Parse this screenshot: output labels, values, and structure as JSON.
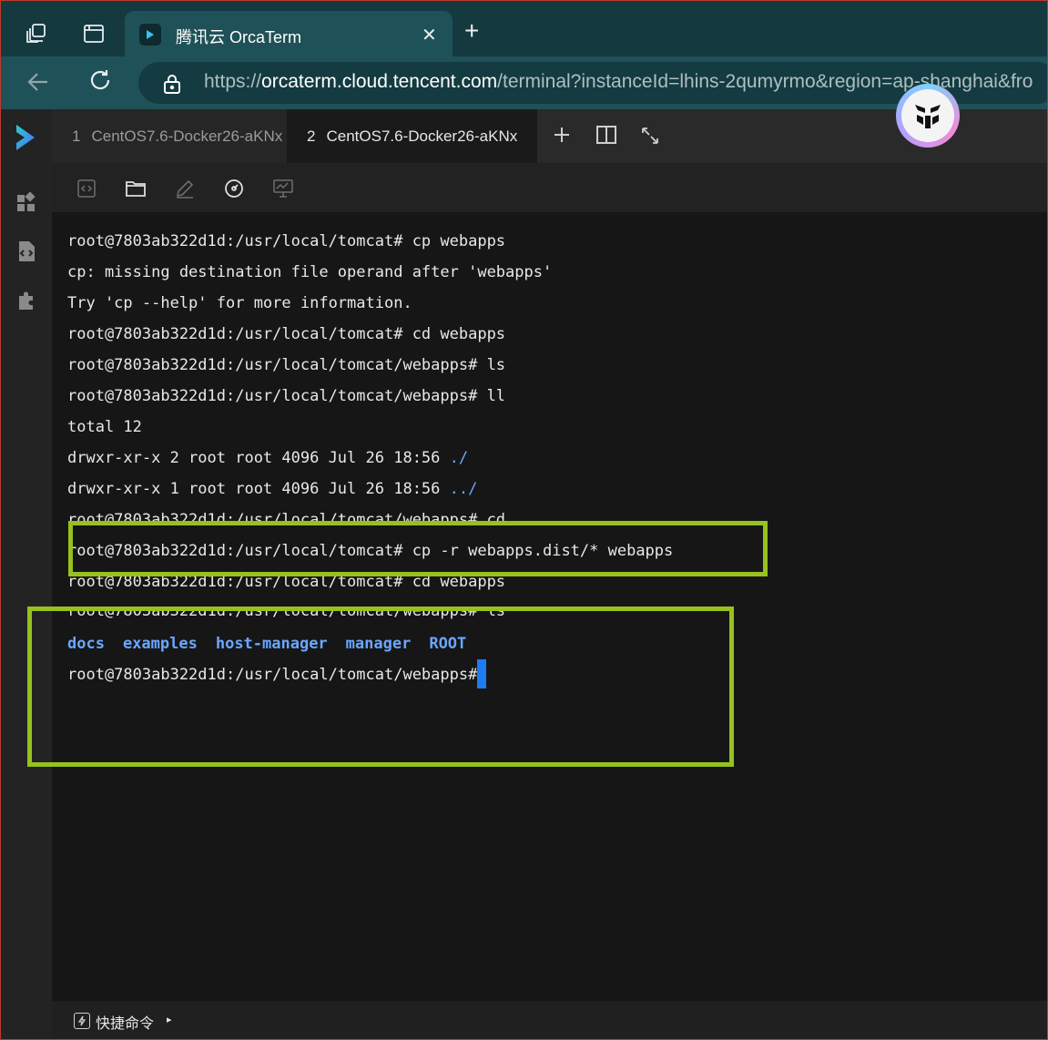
{
  "browser": {
    "tab_title": "腾讯云 OrcaTerm",
    "close_glyph": "✕",
    "new_tab_glyph": "+",
    "url_scheme": "https://",
    "url_host": "orcaterm.cloud.tencent.com",
    "url_path": "/terminal?instanceId=lhins-2qumyrmo&region=ap-shanghai&fro",
    "theme_color": "#1f5158"
  },
  "terminal_tabs": [
    {
      "num": "1",
      "label": "CentOS7.6-Docker26-aKNx"
    },
    {
      "num": "2",
      "label": "CentOS7.6-Docker26-aKNx"
    }
  ],
  "terminal": {
    "lines": [
      "root@7803ab322d1d:/usr/local/tomcat# cp webapps",
      "cp: missing destination file operand after 'webapps'",
      "Try 'cp --help' for more information.",
      "root@7803ab322d1d:/usr/local/tomcat# cd webapps",
      "root@7803ab322d1d:/usr/local/tomcat/webapps# ls",
      "root@7803ab322d1d:/usr/local/tomcat/webapps# ll",
      "total 12",
      "drwxr-xr-x 2 root root 4096 Jul 26 18:56 ",
      "drwxr-xr-x 1 root root 4096 Jul 26 18:56 ",
      "root@7803ab322d1d:/usr/local/tomcat/webapps# cd",
      "root@7803ab322d1d:/usr/local/tomcat# cp -r webapps.dist/* webapps",
      "root@7803ab322d1d:/usr/local/tomcat# cd webapps",
      "root@7803ab322d1d:/usr/local/tomcat/webapps# ls",
      "root@7803ab322d1d:/usr/local/tomcat/webapps# "
    ],
    "dir_entries": [
      "./",
      "../"
    ],
    "ls_output": [
      "docs",
      "examples",
      "host-manager",
      "manager",
      "ROOT"
    ],
    "dir_color": "#6aa7ff",
    "cursor_color": "#1e7bf0",
    "highlight_color": "#96c11e"
  },
  "bottom_bar": {
    "quick_commands_label": "快捷命令",
    "expand_glyph": "▸"
  }
}
